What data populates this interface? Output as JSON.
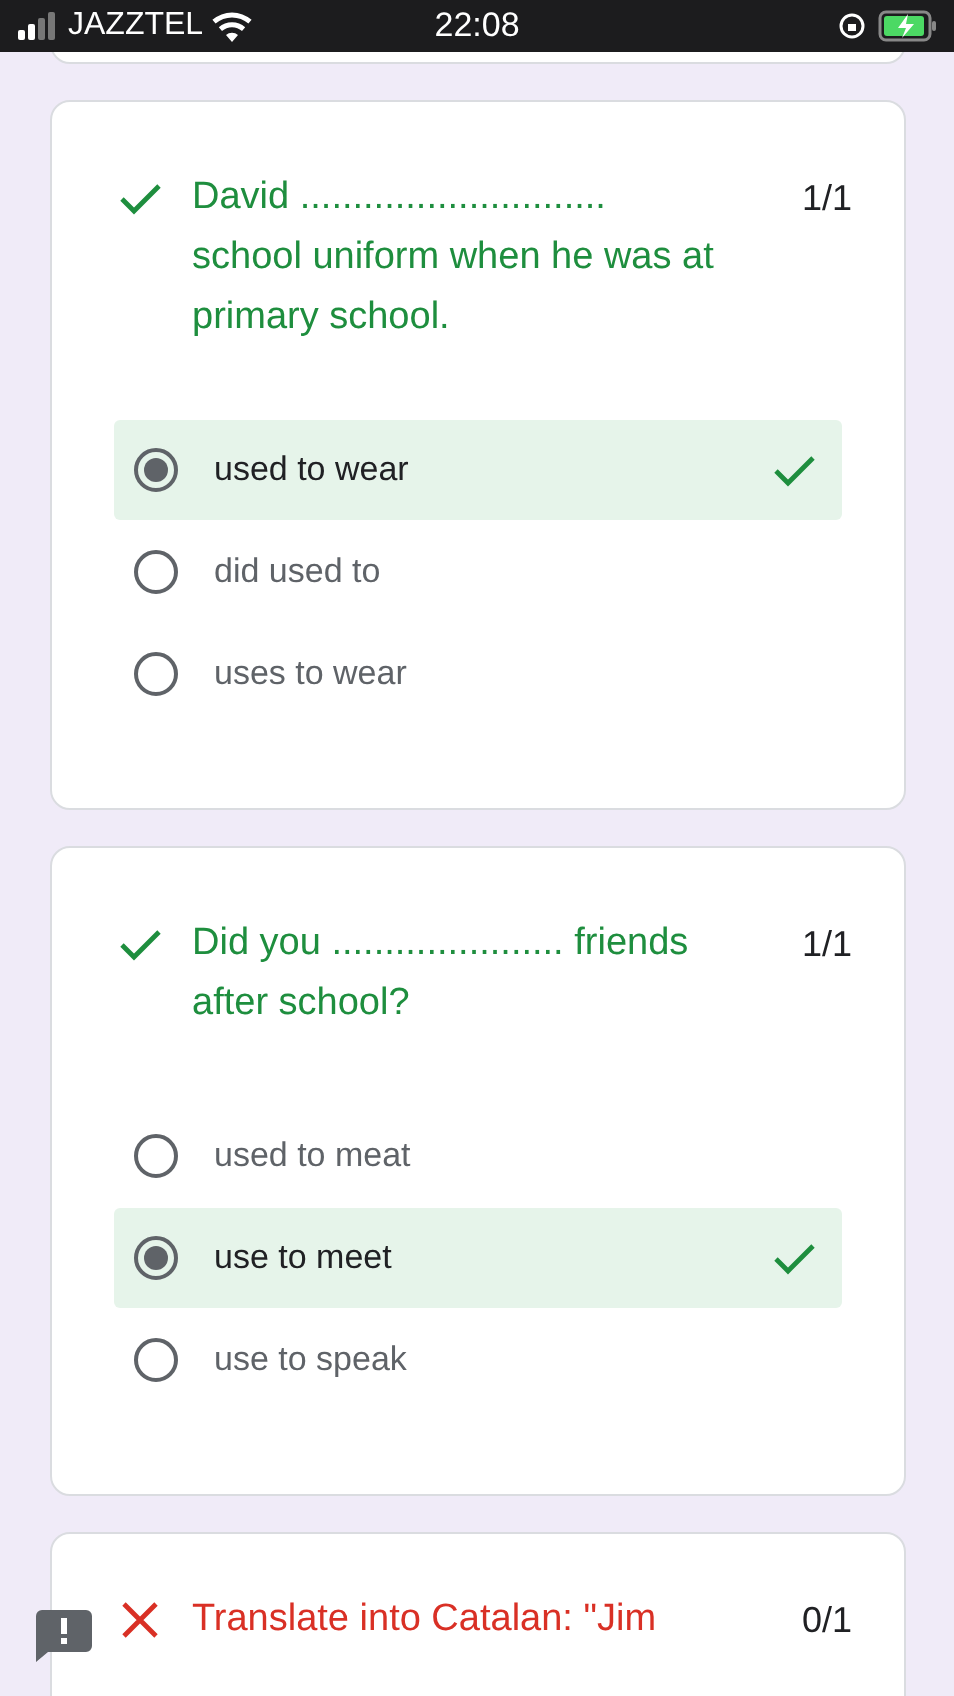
{
  "status_bar": {
    "carrier": "JAZZTEL",
    "time": "22:08"
  },
  "questions": [
    {
      "correct": true,
      "text": "David ............................. school uniform when he was at primary school.",
      "score": "1/1",
      "options": [
        {
          "label": "used to wear",
          "selected": true
        },
        {
          "label": "did used to",
          "selected": false
        },
        {
          "label": "uses to wear",
          "selected": false
        }
      ]
    },
    {
      "correct": true,
      "text": "Did you ...................... friends after school?",
      "score": "1/1",
      "options": [
        {
          "label": "used to meat",
          "selected": false
        },
        {
          "label": "use to meet",
          "selected": true
        },
        {
          "label": "use to speak",
          "selected": false
        }
      ]
    },
    {
      "correct": false,
      "text": "Translate into Catalan: \"Jim",
      "score": "0/1"
    }
  ]
}
